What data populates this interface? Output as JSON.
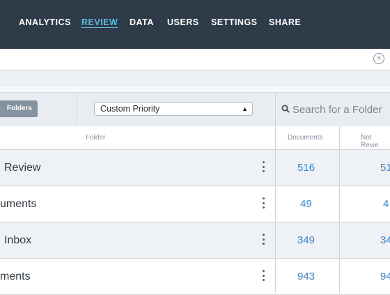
{
  "nav": {
    "items": [
      {
        "label": "ANALYTICS",
        "active": false
      },
      {
        "label": "REVIEW",
        "active": true
      },
      {
        "label": "DATA",
        "active": false
      },
      {
        "label": "USERS",
        "active": false
      },
      {
        "label": "SETTINGS",
        "active": false
      },
      {
        "label": "SHARE",
        "active": false
      }
    ],
    "active_color": "#5fb8d6"
  },
  "filter": {
    "value": "",
    "clear_icon": "close-circle-icon"
  },
  "toolbar": {
    "folders_label": "Folders",
    "sort_select_value": "Custom Priority",
    "search_placeholder": "Search for a Folder",
    "search_icon": "search-icon"
  },
  "table": {
    "headers": {
      "folder": "Folder",
      "documents": "Documents",
      "not_reviewed": "Not Revie"
    },
    "rows": [
      {
        "name": "Review",
        "documents": "516",
        "not_reviewed": "51"
      },
      {
        "name": "uments",
        "documents": "49",
        "not_reviewed": "4"
      },
      {
        "name": "Inbox",
        "documents": "349",
        "not_reviewed": "34"
      },
      {
        "name": "ments",
        "documents": "943",
        "not_reviewed": "94"
      }
    ],
    "link_color": "#3b82c4"
  }
}
